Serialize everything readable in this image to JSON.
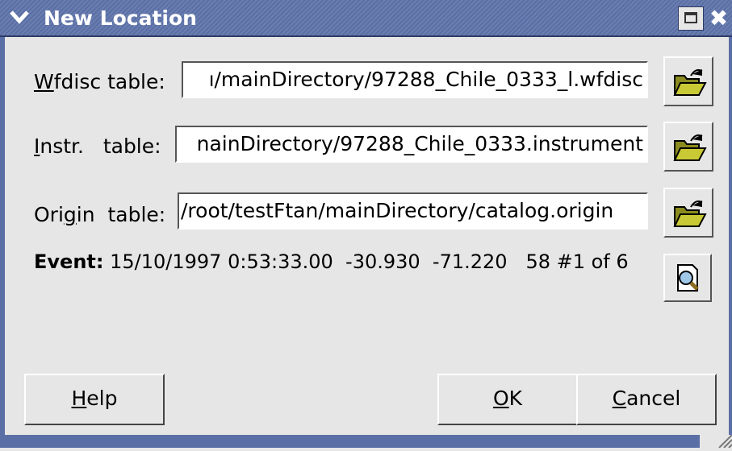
{
  "window": {
    "title": "New Location",
    "menu_icon": "chevron-down-icon",
    "maximize_icon": "maximize-icon",
    "close_icon": "close-icon",
    "title_bar_color": "#5a6fa6"
  },
  "form": {
    "wfdisc": {
      "label_mnemonic": "W",
      "label_rest": "fdisc table:",
      "value": "ı/mainDirectory/97288_Chile_0333_l.wfdisc",
      "browse_icon": "folder-open-icon"
    },
    "instr": {
      "label_mnemonic": "I",
      "label_rest": "nstr.   table:",
      "value": "nainDirectory/97288_Chile_0333.instrument",
      "browse_icon": "folder-open-icon"
    },
    "origin": {
      "label_pre": "Ori",
      "label_mnemonic": "g",
      "label_rest": "in  table:",
      "value": "/root/testFtan/mainDirectory/catalog.origin",
      "browse_icon": "folder-open-icon"
    }
  },
  "event": {
    "label": "Event:",
    "value": "15/10/1997 0:53:33.00  -30.930  -71.220   58 #1 of 6",
    "inspect_icon": "magnifier-document-icon"
  },
  "buttons": {
    "help_mnemonic": "H",
    "help_rest": "elp",
    "ok_mnemonic": "O",
    "ok_rest": "K",
    "cancel_mnemonic": "C",
    "cancel_rest": "ancel"
  }
}
